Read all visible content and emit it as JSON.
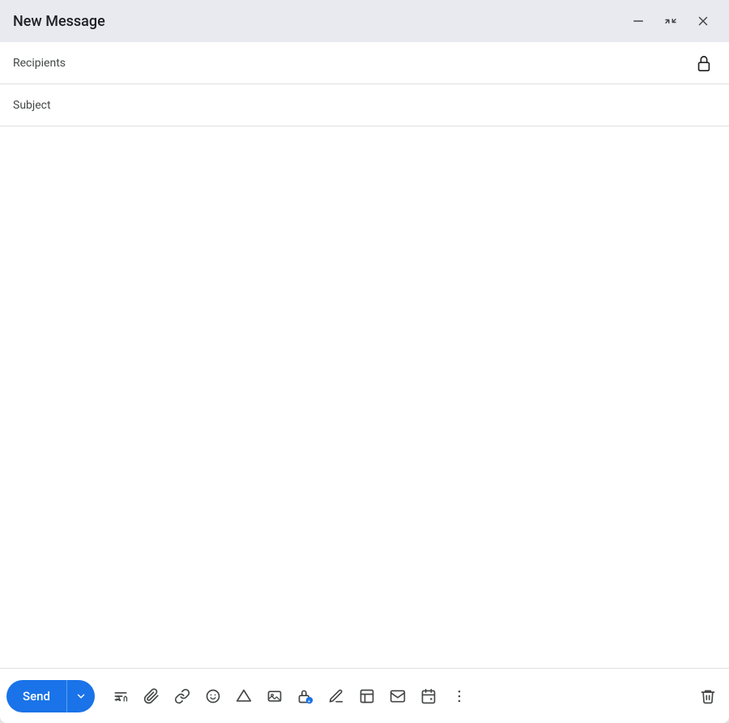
{
  "window": {
    "title": "New Message",
    "minimize_label": "minimize",
    "expand_label": "expand",
    "close_label": "close"
  },
  "fields": {
    "recipients_placeholder": "Recipients",
    "subject_placeholder": "Subject"
  },
  "toolbar": {
    "send_label": "Send",
    "send_dropdown_label": "▾",
    "format_text_label": "Format text",
    "attach_label": "Attach files",
    "link_label": "Insert link",
    "emoji_label": "Insert emoji",
    "drive_label": "Insert from Drive",
    "photo_label": "Insert photo",
    "lock_label": "Toggle confidential mode",
    "signature_label": "Insert signature",
    "template_label": "More options",
    "labels_label": "Labels",
    "schedule_label": "Schedule send",
    "more_label": "More options",
    "delete_label": "Discard draft"
  },
  "colors": {
    "accent": "#1a73e8",
    "title_bar_bg": "#e8eaf0",
    "text_primary": "#202124",
    "text_secondary": "#444746",
    "border": "#e0e0e0"
  }
}
